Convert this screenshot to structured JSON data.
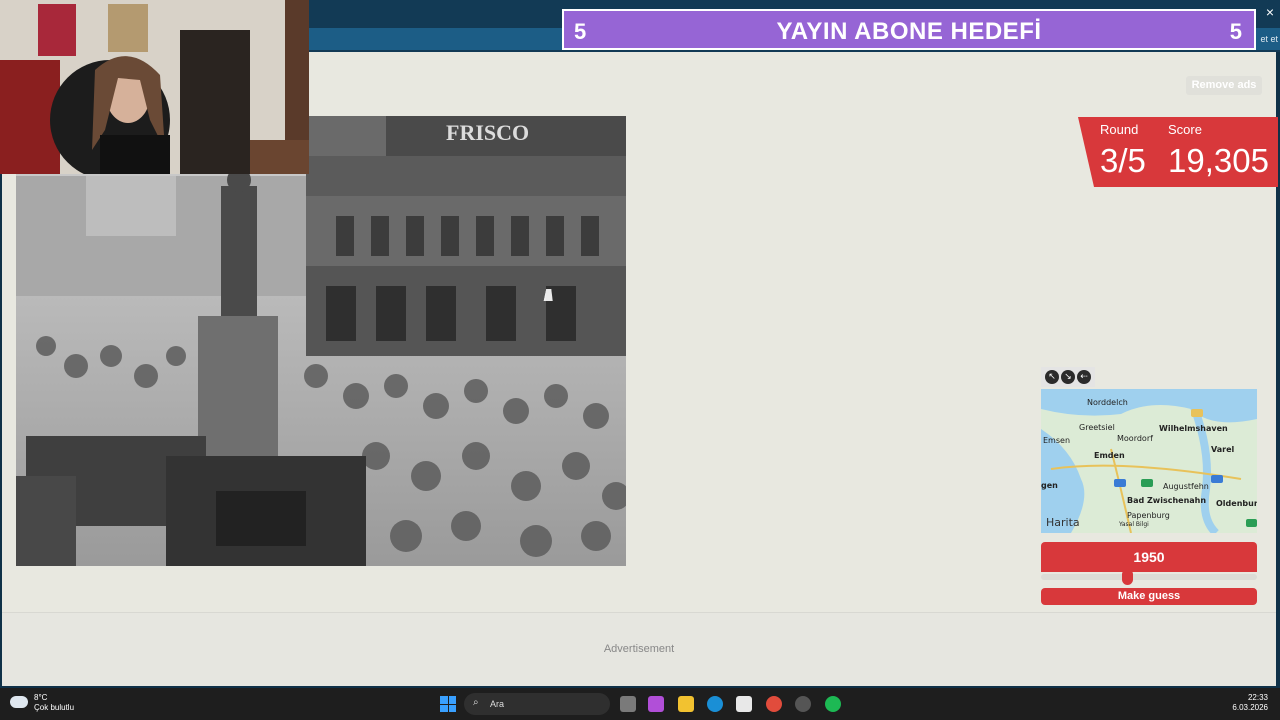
{
  "stream_goal": {
    "left_count": "5",
    "title": "YAYIN ABONE HEDEFİ",
    "right_count": "5"
  },
  "topbar": {
    "close_glyph": "×",
    "small_button": "et et"
  },
  "header": {
    "remove_ads": "Remove ads"
  },
  "score_panel": {
    "round_label": "Round",
    "round_value": "3/5",
    "score_label": "Score",
    "score_value": "19,305"
  },
  "map": {
    "labels": [
      "Norddelch",
      "Greetsiel",
      "Moordorf",
      "Wilhelmshaven",
      "Emsen",
      "Emden",
      "Varel",
      "gen",
      "Augustfehn",
      "Bad Zwischenahn",
      "Oldenburg",
      "Papenburg",
      "Yasal Bilgi",
      "Harita"
    ],
    "attribution": "Harita"
  },
  "guess": {
    "year": "1950",
    "year_slider_fraction": 0.4,
    "button": "Make guess"
  },
  "ad": {
    "label": "Advertisement"
  },
  "taskbar": {
    "weather_temp": "8°C",
    "weather_desc": "Çok bulutlu",
    "search_placeholder": "Ara",
    "time": "22:33",
    "date": "6.03.2026"
  },
  "colors": {
    "accent": "#d8383b",
    "goal_bg": "#9665d5",
    "page_bg": "#e8e8e0"
  }
}
